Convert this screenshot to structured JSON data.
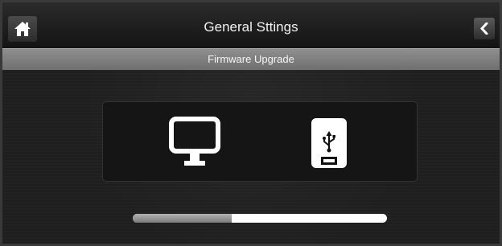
{
  "header": {
    "title": "General Sttings",
    "home_icon": "home-icon",
    "back_icon": "chevron-left-icon"
  },
  "subheader": {
    "title": "Firmware Upgrade"
  },
  "options": [
    {
      "name": "monitor",
      "icon": "monitor-icon"
    },
    {
      "name": "usb",
      "icon": "usb-drive-icon"
    }
  ],
  "progress": {
    "fraction": 0.39
  },
  "colors": {
    "background": "#1f1f1f",
    "subheader": "#7f7f7f",
    "progress_track": "#ffffff",
    "progress_fill": "#8a8a8a"
  }
}
